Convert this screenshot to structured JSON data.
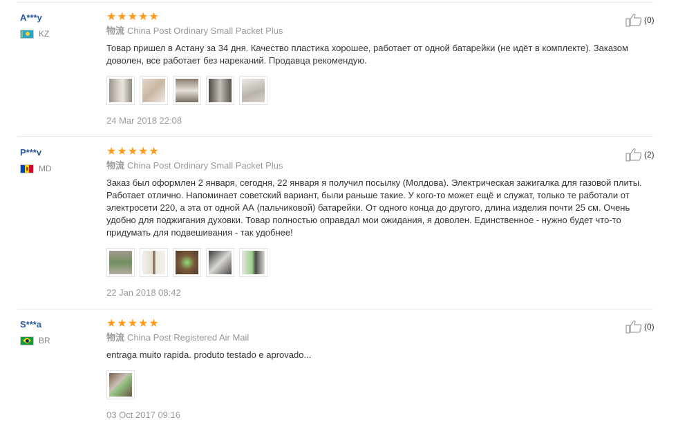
{
  "reviews": [
    {
      "user": "A***y",
      "country": "KZ",
      "flag": "kz",
      "stars": 5,
      "logistics_label": "物流",
      "logistics": "China Post Ordinary Small Packet Plus",
      "text": "Товар пришел в Астану за 34 дня. Качество пластика хорошее, работает от одной батарейки (не идёт в комплекте). Заказом доволен, все работает без нареканий. Продавца рекомендую.",
      "photos": [
        "#b9b3a8",
        "#d8cbbd",
        "#9c8f80",
        "#6f6960",
        "#cfc9c3"
      ],
      "date": "24 Mar 2018 22:08",
      "helpful": "(0)"
    },
    {
      "user": "P***v",
      "country": "MD",
      "flag": "md",
      "stars": 5,
      "logistics_label": "物流",
      "logistics": "China Post Ordinary Small Packet Plus",
      "text": "Заказ был оформлен 2 января, сегодня, 22 января я получил посылку (Молдова). Электрическая зажигалка для газовой плиты. Работает отлично. Напоминает советский вариант, были раньше такие. У кого-то может ещё и служат, только те работали от электросети 220, а эта от одной АА (пальчиковой) батарейки. От одного конца до другого, длина изделия почти 25 см. Очень удобно для поджигания духовки. Товар полностью оправдал мои ожидания, я доволен. Единственное - нужно будет что-то придумать для подвешивания - так удобнее!",
      "photos": [
        "#8d8579",
        "#e0dad2",
        "#7a5a3a",
        "#5c5a58",
        "#bfbdb8"
      ],
      "date": "22 Jan 2018 08:42",
      "helpful": "(2)"
    },
    {
      "user": "S***a",
      "country": "BR",
      "flag": "br",
      "stars": 5,
      "logistics_label": "物流",
      "logistics": "China Post Registered Air Mail",
      "text": "entraga muito rapida. produto testado e aprovado...",
      "photos": [
        "#8a7a6a"
      ],
      "date": "03 Oct 2017 09:16",
      "helpful": "(0)"
    }
  ]
}
